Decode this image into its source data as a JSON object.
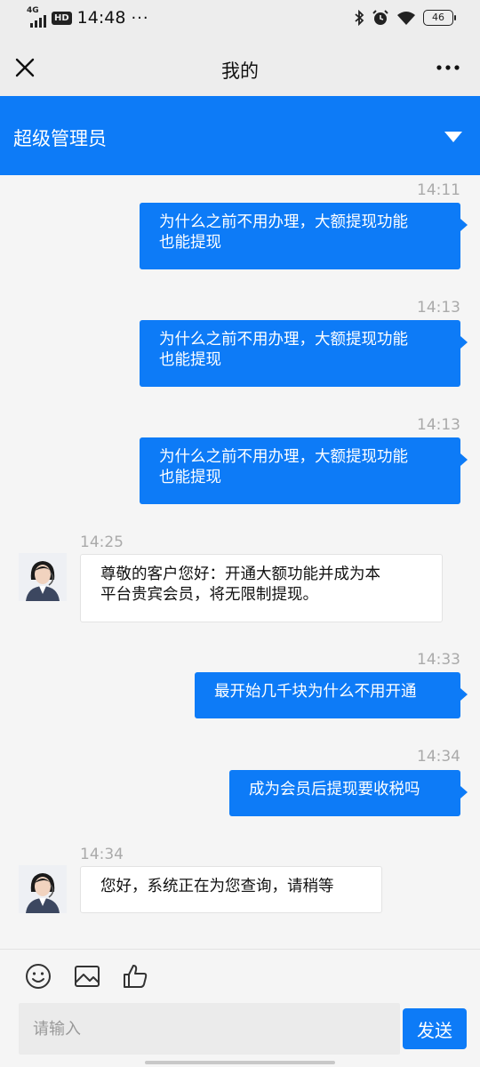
{
  "status_bar": {
    "network": "4G",
    "hd_label": "HD",
    "time": "14:48",
    "dots": "···",
    "battery": "46"
  },
  "header": {
    "title": "我的",
    "close_icon": "close-icon",
    "more_icon": "more-icon"
  },
  "agent": {
    "name": "超级管理员",
    "dropdown_icon": "triangle-down-icon"
  },
  "messages": [
    {
      "time": "14:11",
      "side": "out",
      "text_line1": "为什么之前不用办理，大额提现功能",
      "text_line2": "也能提现"
    },
    {
      "time": "14:13",
      "side": "out",
      "text_line1": "为什么之前不用办理，大额提现功能",
      "text_line2": "也能提现"
    },
    {
      "time": "14:13",
      "side": "out",
      "text_line1": "为什么之前不用办理，大额提现功能",
      "text_line2": "也能提现"
    },
    {
      "time": "14:25",
      "side": "in",
      "text_line1": "尊敬的客户您好：开通大额功能并成为本",
      "text_line2": "平台贵宾会员，将无限制提现。"
    },
    {
      "time": "14:33",
      "side": "out",
      "text_line1": "最开始几千块为什么不用开通"
    },
    {
      "time": "14:34",
      "side": "out",
      "text_line1": "成为会员后提现要收税吗"
    },
    {
      "time": "14:34",
      "side": "in",
      "text_line1": "您好，系统正在为您查询，请稍等"
    }
  ],
  "toolbar": {
    "emoji_icon": "emoji-icon",
    "image_icon": "image-icon",
    "like_icon": "thumbs-up-icon"
  },
  "input": {
    "placeholder": "请输入",
    "value": ""
  },
  "send_label": "发送",
  "colors": {
    "accent": "#0d7bf7",
    "header_bg": "#ededed",
    "chat_bg": "#f5f5f5"
  }
}
